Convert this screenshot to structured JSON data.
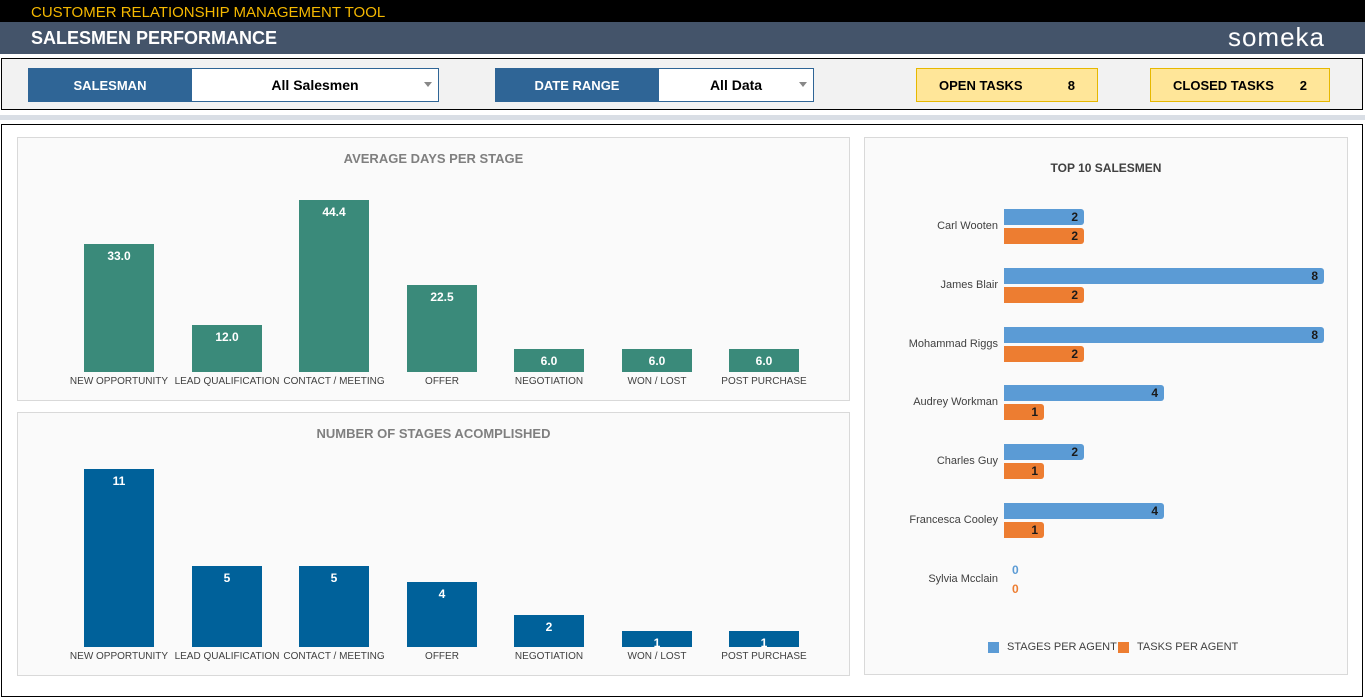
{
  "app_title": "CUSTOMER RELATIONSHIP MANAGEMENT TOOL",
  "page_title": "SALESMEN PERFORMANCE",
  "logo": "someka",
  "filters": {
    "salesman_label": "SALESMAN",
    "salesman_value": "All Salesmen",
    "date_label": "DATE RANGE",
    "date_value": "All Data"
  },
  "tasks": {
    "open_label": "OPEN TASKS",
    "open_value": "8",
    "closed_label": "CLOSED TASKS",
    "closed_value": "2"
  },
  "colors": {
    "teal": "#3a8a7a",
    "blue": "#00619a",
    "stages": "#5b9bd5",
    "tasks": "#ed7d31"
  },
  "chart_data": [
    {
      "type": "bar",
      "title": "AVERAGE DAYS PER STAGE",
      "categories": [
        "NEW OPPORTUNITY",
        "LEAD QUALIFICATION",
        "CONTACT / MEETING",
        "OFFER",
        "NEGOTIATION",
        "WON / LOST",
        "POST PURCHASE"
      ],
      "values": [
        33.0,
        12.0,
        44.4,
        22.5,
        6.0,
        6.0,
        6.0
      ],
      "labels": [
        "33.0",
        "12.0",
        "44.4",
        "22.5",
        "6.0",
        "6.0",
        "6.0"
      ]
    },
    {
      "type": "bar",
      "title": "NUMBER OF STAGES ACOMPLISHED",
      "categories": [
        "NEW OPPORTUNITY",
        "LEAD QUALIFICATION",
        "CONTACT / MEETING",
        "OFFER",
        "NEGOTIATION",
        "WON / LOST",
        "POST PURCHASE"
      ],
      "values": [
        11,
        5,
        5,
        4,
        2,
        1,
        1
      ],
      "labels": [
        "11",
        "5",
        "5",
        "4",
        "2",
        "1",
        "1"
      ]
    },
    {
      "type": "bar",
      "orientation": "horizontal",
      "title": "TOP 10 SALESMEN",
      "categories": [
        "Carl Wooten",
        "James Blair",
        "Mohammad Riggs",
        "Audrey Workman",
        "Charles Guy",
        "Francesca Cooley",
        "Sylvia Mcclain"
      ],
      "series": [
        {
          "name": "STAGES PER AGENT",
          "values": [
            2,
            8,
            8,
            4,
            2,
            4,
            0
          ]
        },
        {
          "name": "TASKS PER AGENT",
          "values": [
            2,
            2,
            2,
            1,
            1,
            1,
            0
          ]
        }
      ],
      "legend": "bottom"
    }
  ]
}
